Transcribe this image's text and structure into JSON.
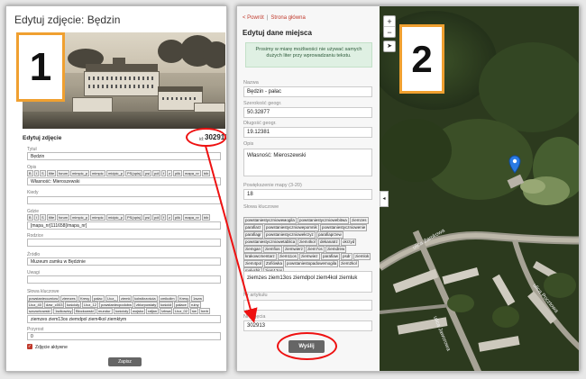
{
  "left": {
    "title": "Edytuj zdjęcie: Będzin",
    "badge": "1",
    "edit_heading": "Edytuj zdjęcie",
    "id_label": "id:",
    "id_value": "302913",
    "fields": {
      "tytul_label": "Tytuł",
      "tytul_value": "Będzin",
      "opis_label": "Opis",
      "opis_value": "Własność: Mieroszewski",
      "kiedy_label": "Kiedy",
      "kiedy_value": "",
      "gdzie_label": "Gdzie",
      "gdzie_value": "[mapa_nr]111658[/mapa_nr]",
      "rodzice_label": "Rodzice",
      "rodzice_value": "",
      "zrodlo_label": "Źródło",
      "zrodlo_value": "Muzeum zamku w Będzinie",
      "uwagi_label": "Uwagi",
      "uwagi_value": "",
      "slowa_label": "Słowa kluczowe",
      "slowa_value": "ziemzes ziem13os ziemdpol ziem4kol ziemktym",
      "przyrost_label": "Przyrost",
      "przyrost_value": "0"
    },
    "toolbar": [
      "B",
      "I",
      "S",
      "tlite",
      "forum",
      "mimpic_p",
      "mimpic",
      "midpic_p",
      "PS(opis)",
      "psi",
      "pdi",
      "f",
      "z",
      "plik",
      "mapa_nr",
      "bib"
    ],
    "tags": [
      "powstaniecczniow",
      "ziemzes",
      "Kresy",
      "pałac",
      "Ltcz_",
      "ziemk",
      "kolwikrzościa",
      "cmikolim",
      "Kresy",
      "1wzw",
      "Ltcz_40",
      "dzsr_c003",
      "kościoły",
      "Ltcz_12",
      "powstaniecpodobw",
      "zbiorpowiaty",
      "kościół",
      "pałace",
      "ruiny",
      "szczurkowski",
      "1sdkowicy",
      "Błockowski",
      "mundur",
      "kościoły",
      "wojsko",
      "rafjan",
      "Izbwa",
      "Ltcz_02",
      "św",
      "herb"
    ],
    "checkbox_label": "Zdjęcie aktywne",
    "save_label": "Zapisz"
  },
  "right": {
    "nav_back": "< Powrót",
    "nav_sep": "|",
    "nav_home": "Strona główna",
    "heading": "Edytuj dane miejsca",
    "info": "Prosimy w miarę możliwości nie używać samych dużych liter przy wprowadzaniu tekstu.",
    "nazwa_label": "Nazwa",
    "nazwa_value": "Będzin - pałac",
    "lat_label": "Szerokość geogr.",
    "lat_value": "50.32877",
    "lon_label": "Długość geogr.",
    "lon_value": "19.12381",
    "opis_label": "Opis",
    "opis_value": "Własność: Mieroszewski",
    "zoom_label": "Powiększenie mapy (3-20)",
    "zoom_value": "18",
    "keywords_label": "Słowa kluczowe",
    "tags": [
      "powstaniestycznioweмogila",
      "powstaniestyczniowebitwa",
      "ziemzes",
      "parafiarz",
      "powstaniestyczniowepomnik",
      "powstaniestyczniowenie",
      "parafiagr",
      "powstaniestyczniowekrzyz",
      "parafiaprzew",
      "powstaniestyczniowetablica",
      "ziem4kol",
      "dekanatrz",
      "okrzyd",
      "ziemgan",
      "ziemfios",
      "ziemwierz",
      "ziem7os",
      "ziemdrew",
      "krakowcmentarz",
      "ziem11os",
      "ziemwiez",
      "parafiaw",
      "psdr",
      "ziemlok",
      "ziem4pol",
      "Zofiówka",
      "powstaniestopadowemogila",
      "ziem2kol",
      "malysbit",
      "ziem13os"
    ],
    "keywords_value": "ziemzes ziem13os ziemdpol ziem4kol ziemluk",
    "artykul_label": "Nr artykułu",
    "artykul_value": "",
    "zdjecie_label": "Nr zdjęcia",
    "zdjecie_value": "302913",
    "save_label": "Wyślij",
    "map_badge": "2",
    "streets": [
      "ulica Zamkowa",
      "ulica Jaworowa",
      "ulica Pocztowa"
    ]
  }
}
